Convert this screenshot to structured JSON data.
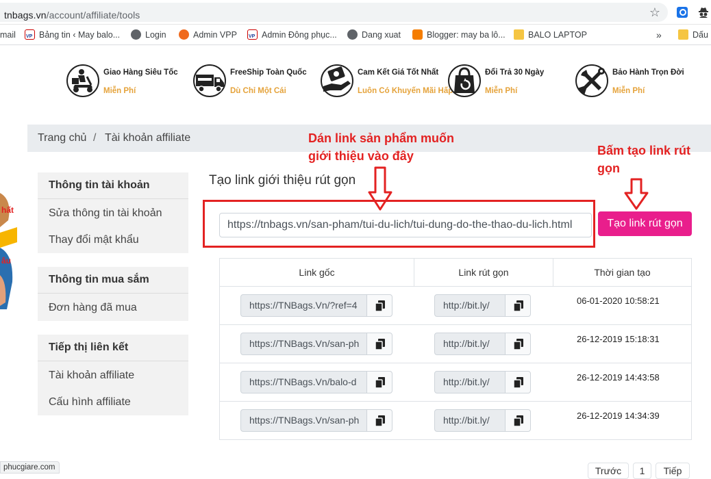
{
  "browser": {
    "url_host": "tnbags.vn",
    "url_path": "/account/affiliate/tools",
    "bookmarks": [
      {
        "label": "mail",
        "icon": "gmail-icon"
      },
      {
        "label": "Bảng tin ‹ May balo...",
        "icon": "vp-logo-icon"
      },
      {
        "label": "Login",
        "icon": "globe-icon"
      },
      {
        "label": "Admin VPP",
        "icon": "vpp-icon"
      },
      {
        "label": "Admin Đông phục...",
        "icon": "vp-logo-icon"
      },
      {
        "label": "Dang xuat",
        "icon": "globe-icon"
      },
      {
        "label": "Blogger: may ba lô...",
        "icon": "blogger-icon"
      },
      {
        "label": "BALO LAPTOP",
        "icon": "folder-icon"
      },
      {
        "label": "»",
        "icon": ""
      },
      {
        "label": "Dấu",
        "icon": "folder-icon"
      }
    ]
  },
  "features": [
    {
      "title": "Giao Hàng Siêu Tốc",
      "sub": "Miễn Phí",
      "icon": "delivery-scooter-icon"
    },
    {
      "title": "FreeShip Toàn Quốc",
      "sub": "Dù Chỉ Một Cái",
      "icon": "truck-icon"
    },
    {
      "title": "Cam Kết Giá Tốt Nhất",
      "sub": "Luôn Có Khuyến Mãi Hấp Dẫn",
      "icon": "money-hand-icon"
    },
    {
      "title": "Đổi Trả 30 Ngày",
      "sub": "Miễn Phí",
      "icon": "shopping-bag-icon"
    },
    {
      "title": "Bảo Hành Trọn Đời",
      "sub": "Miễn Phí",
      "icon": "wrench-screwdriver-icon"
    }
  ],
  "breadcrumb": {
    "home": "Trang chủ",
    "separator": "/",
    "current": "Tài khoản affiliate"
  },
  "sidebar": {
    "account": {
      "title": "Thông tin tài khoản",
      "items": [
        "Sửa thông tin tài khoản",
        "Thay đổi mật khẩu"
      ]
    },
    "shopping": {
      "title": "Thông tin mua sắm",
      "items": [
        "Đơn hàng đã mua"
      ]
    },
    "affiliate": {
      "title": "Tiếp thị liên kết",
      "items": [
        "Tài khoản affiliate",
        "Cấu hình affiliate"
      ]
    }
  },
  "left_banner": {
    "text1": "hất",
    "text2": "âu"
  },
  "main": {
    "title": "Tạo link giới thiệu rút gọn",
    "url_value": "https://tnbags.vn/san-pham/tui-du-lich/tui-dung-do-the-thao-du-lich.html",
    "create_button": "Tạo link rút gọn"
  },
  "annotations": {
    "paste": [
      "Dán link sản phẩm muốn",
      "giới thiệu vào đây"
    ],
    "click": [
      "Bấm tạo link rút",
      "gọn"
    ],
    "color": "#e32222"
  },
  "table": {
    "headers": [
      "Link gốc",
      "Link rút gọn",
      "Thời gian tạo"
    ],
    "rows": [
      {
        "original": "https://TNBags.Vn/?ref=4",
        "short": "http://bit.ly/",
        "date": "06-01-2020 10:58:21"
      },
      {
        "original": "https://TNBags.Vn/san-ph",
        "short": "http://bit.ly/",
        "date": "26-12-2019 15:18:31"
      },
      {
        "original": "https://TNBags.Vn/balo-d",
        "short": "http://bit.ly/",
        "date": "26-12-2019 14:43:58"
      },
      {
        "original": "https://TNBags.Vn/san-ph",
        "short": "http://bit.ly/",
        "date": "26-12-2019 14:34:39"
      }
    ]
  },
  "pagination": {
    "prev": "Trước",
    "page": "1",
    "next": "Tiếp"
  },
  "status_bar": "phucgiare.com",
  "colors": {
    "accent_pink": "#e91e8c",
    "feature_orange": "#e5a33b",
    "breadcrumb_bg": "#e9ecef",
    "sidebar_bg": "#f2f2f2"
  }
}
